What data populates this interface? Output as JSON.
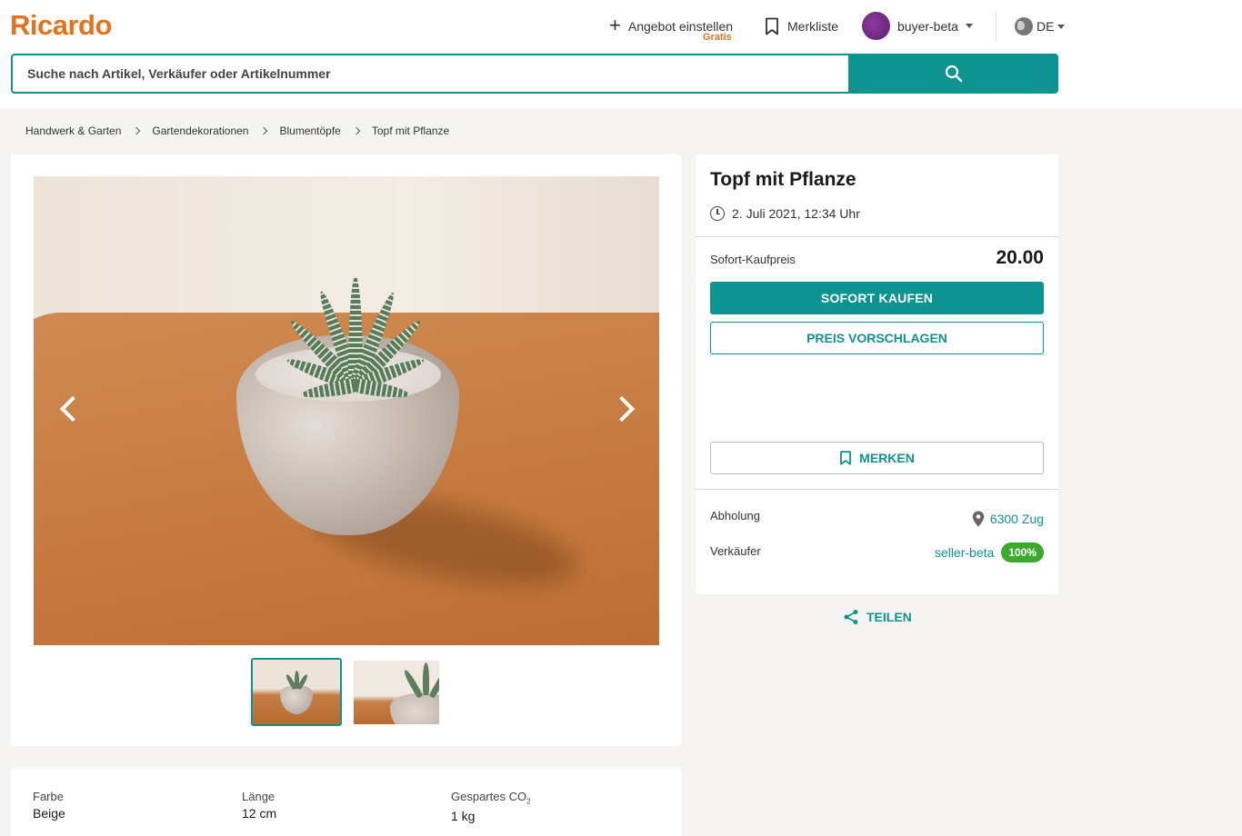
{
  "header": {
    "logo": "Ricardo",
    "sell_label": "Angebot einstellen",
    "sell_sub": "Gratis",
    "watchlist_label": "Merkliste",
    "username": "buyer-beta",
    "language": "DE"
  },
  "search": {
    "placeholder": "Suche nach Artikel, Verkäufer oder Artikelnummer"
  },
  "breadcrumb": [
    "Handwerk & Garten",
    "Gartendekorationen",
    "Blumentöpfe",
    "Topf mit Pflanze"
  ],
  "gallery": {
    "images": [
      "main-plant-photo",
      "plant-side-photo"
    ],
    "selected": 0
  },
  "attributes": [
    {
      "label": "Farbe",
      "value": "Beige"
    },
    {
      "label": "Länge",
      "value": "12 cm"
    },
    {
      "label": "Gespartes CO",
      "label_sub": "2",
      "value": "1 kg"
    }
  ],
  "product": {
    "title": "Topf mit Pflanze",
    "end_date": "2. Juli 2021, 12:34 Uhr",
    "price_label": "Sofort-Kaufpreis",
    "price": "20.00",
    "buy_now": "SOFORT KAUFEN",
    "suggest_price": "PREIS VORSCHLAGEN",
    "watch": "MERKEN",
    "pickup_label": "Abholung",
    "pickup_location": "6300 Zug",
    "seller_label": "Verkäufer",
    "seller_name": "seller-beta",
    "seller_rating": "100%",
    "share": "TEILEN"
  },
  "colors": {
    "accent": "#0e9490",
    "brand": "#e3731c",
    "rating_badge": "#3aa92e"
  }
}
